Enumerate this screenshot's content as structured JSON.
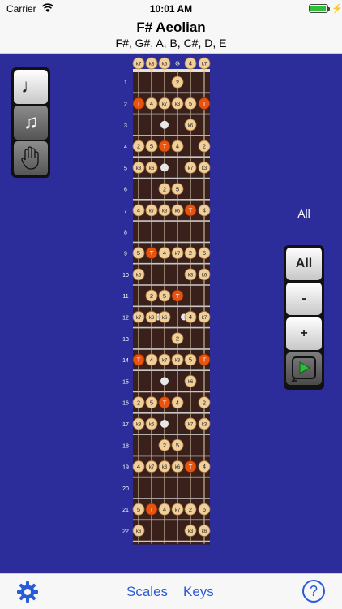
{
  "status": {
    "carrier": "Carrier",
    "time": "10:01 AM"
  },
  "header": {
    "title": "F# Aeolian",
    "notes": "F#, G#, A, B, C#, D, E"
  },
  "side_label": "All",
  "controls": {
    "all": "All",
    "minus": "-",
    "plus": "+"
  },
  "tabs": {
    "scales": "Scales",
    "keys": "Keys",
    "help": "?"
  },
  "icons": {
    "tool1": "single-note-icon",
    "tool2": "double-note-icon",
    "tool3": "hand-icon",
    "play": "play-loop-icon",
    "settings": "gear-icon"
  },
  "colors": {
    "board_bg": "#2c2c9a",
    "neck": "#3a201a",
    "note_fill": "#f1cf9b",
    "tonic_fill": "#e8540f",
    "link": "#2a5bd7"
  },
  "fretboard": {
    "open_strings": [
      "k7",
      "k3",
      "k6",
      "G",
      "4",
      "k7"
    ],
    "fret_numbers": [
      "1",
      "2",
      "3",
      "4",
      "5",
      "6",
      "7",
      "8",
      "9",
      "10",
      "11",
      "12",
      "13",
      "14",
      "15",
      "16",
      "17",
      "18",
      "19",
      "20",
      "21",
      "22"
    ],
    "frets": [
      [
        "",
        "",
        "",
        "2",
        "",
        ""
      ],
      [
        "T",
        "4",
        "k7",
        "k3",
        "5",
        "T"
      ],
      [
        "",
        "",
        "",
        "",
        "k6",
        ""
      ],
      [
        "2",
        "5",
        "T",
        "4",
        "",
        "2"
      ],
      [
        "k3",
        "k6",
        "",
        "",
        "k7",
        "k3"
      ],
      [
        "",
        "",
        "2",
        "5",
        "",
        ""
      ],
      [
        "4",
        "k7",
        "k3",
        "k6",
        "T",
        "4"
      ],
      [
        "",
        "",
        "",
        "",
        "",
        ""
      ],
      [
        "5",
        "T",
        "4",
        "k7",
        "2",
        "5"
      ],
      [
        "k6",
        "",
        "",
        "",
        "k3",
        "k6"
      ],
      [
        "",
        "2",
        "5",
        "T",
        "",
        ""
      ],
      [
        "k7",
        "k3",
        "k6",
        "",
        "4",
        "k7"
      ],
      [
        "",
        "",
        "",
        "2",
        "",
        ""
      ],
      [
        "T",
        "4",
        "k7",
        "k3",
        "5",
        "T"
      ],
      [
        "",
        "",
        "",
        "",
        "k6",
        ""
      ],
      [
        "2",
        "5",
        "T",
        "4",
        "",
        "2"
      ],
      [
        "k3",
        "k6",
        "",
        "",
        "k7",
        "k3"
      ],
      [
        "",
        "",
        "2",
        "5",
        "",
        ""
      ],
      [
        "4",
        "k7",
        "k3",
        "k6",
        "T",
        "4"
      ],
      [
        "",
        "",
        "",
        "",
        "",
        ""
      ],
      [
        "5",
        "T",
        "4",
        "k7",
        "2",
        "5"
      ],
      [
        "k6",
        "",
        "",
        "",
        "k3",
        "k6"
      ]
    ],
    "inlay_frets": [
      3,
      5,
      7,
      9,
      15,
      17
    ],
    "double_inlay_frets": [
      12
    ]
  }
}
